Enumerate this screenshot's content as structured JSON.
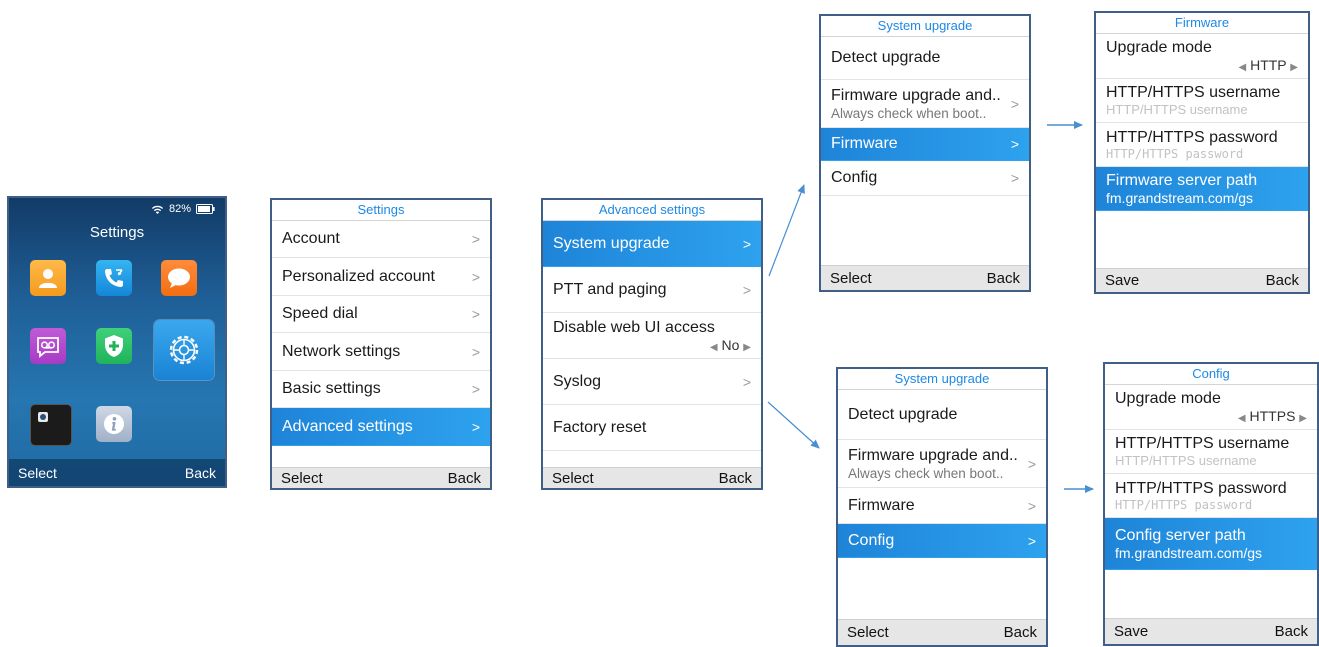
{
  "home": {
    "title": "Settings",
    "battery": "82%",
    "softkeys": {
      "left": "Select",
      "right": "Back"
    },
    "icons": [
      "contacts-icon",
      "call-history-icon",
      "messages-icon",
      "voicemail-icon",
      "security-icon",
      "settings-icon",
      "camera-icon",
      "info-icon"
    ]
  },
  "settings": {
    "title": "Settings",
    "items": [
      "Account",
      "Personalized account",
      "Speed dial",
      "Network settings",
      "Basic settings",
      "Advanced settings"
    ],
    "softkeys": {
      "left": "Select",
      "right": "Back"
    }
  },
  "advanced": {
    "title": "Advanced settings",
    "items": [
      "System upgrade",
      "PTT and paging",
      "Disable web UI access",
      "Syslog",
      "Factory reset"
    ],
    "web_ui_value": "No",
    "softkeys": {
      "left": "Select",
      "right": "Back"
    }
  },
  "sysupgrade_top": {
    "title": "System upgrade",
    "items": [
      "Detect upgrade",
      "Firmware upgrade and..",
      "Firmware",
      "Config"
    ],
    "firmware_upgrade_sub": "Always check when boot..",
    "softkeys": {
      "left": "Select",
      "right": "Back"
    }
  },
  "firmware": {
    "title": "Firmware",
    "upgrade_mode_label": "Upgrade mode",
    "upgrade_mode_value": "HTTP",
    "username_label": "HTTP/HTTPS username",
    "username_placeholder": "HTTP/HTTPS username",
    "password_label": "HTTP/HTTPS password",
    "password_placeholder": "HTTP/HTTPS password",
    "server_label": "Firmware server path",
    "server_value": "fm.grandstream.com/gs",
    "softkeys": {
      "left": "Save",
      "right": "Back"
    }
  },
  "sysupgrade_bottom": {
    "title": "System upgrade",
    "items": [
      "Detect upgrade",
      "Firmware upgrade and..",
      "Firmware",
      "Config"
    ],
    "firmware_upgrade_sub": "Always check when boot..",
    "softkeys": {
      "left": "Select",
      "right": "Back"
    }
  },
  "config": {
    "title": "Config",
    "upgrade_mode_label": "Upgrade mode",
    "upgrade_mode_value": "HTTPS",
    "username_label": "HTTP/HTTPS username",
    "username_placeholder": "HTTP/HTTPS username",
    "password_label": "HTTP/HTTPS password",
    "password_placeholder": "HTTP/HTTPS password",
    "server_label": "Config server path",
    "server_value": "fm.grandstream.com/gs",
    "softkeys": {
      "left": "Save",
      "right": "Back"
    }
  },
  "colors": {
    "accent": "#1e88e5",
    "selected": "#2ea2ee",
    "frame": "#3f5f86",
    "arrow": "#4a8fd1"
  }
}
